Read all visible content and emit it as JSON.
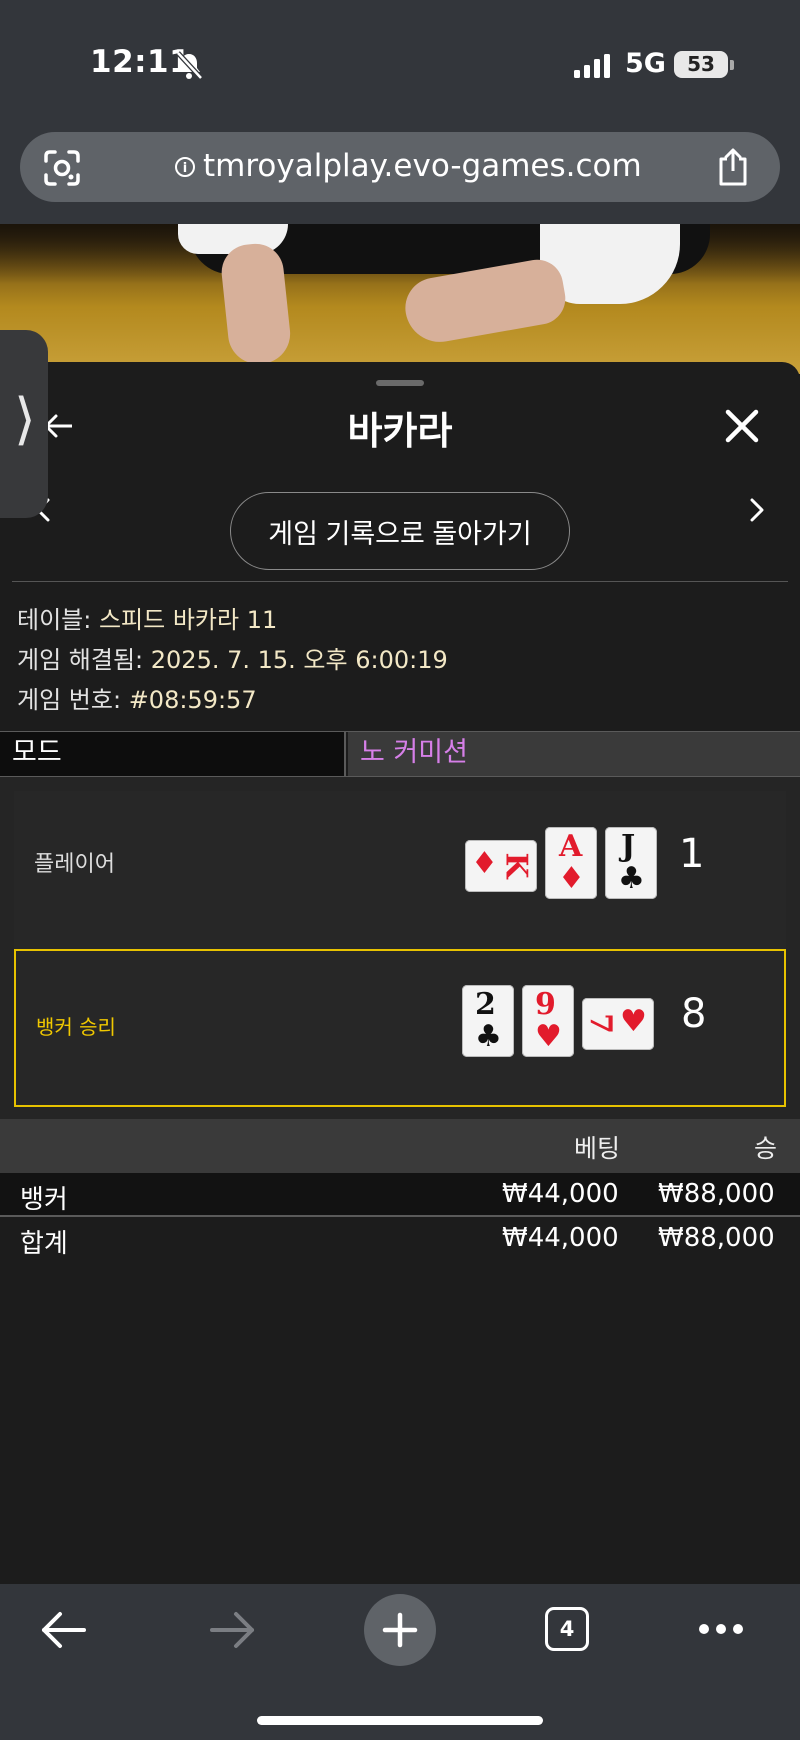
{
  "status": {
    "time": "12:11",
    "network": "5G",
    "battery": "53"
  },
  "browser": {
    "url": "tmroyalplay.evo-games.com",
    "tab_count": "4"
  },
  "panel": {
    "title": "바카라",
    "back_to_history": "게임 기록으로 돌아가기",
    "table_label": "테이블:",
    "table_value": "스피드 바카라 11",
    "resolved_label": "게임 해결됨:",
    "resolved_value": "2025. 7. 15. 오후 6:00:19",
    "game_no_label": "게임 번호:",
    "game_no_value": "#08:59:57",
    "mode_label": "모드",
    "mode_value": "노 커미션"
  },
  "hands": {
    "player": {
      "label": "플레이어",
      "score": "1",
      "cards": [
        {
          "rank": "K",
          "suit": "♦",
          "color": "red",
          "orientation": "horizontal"
        },
        {
          "rank": "A",
          "suit": "♦",
          "color": "red",
          "orientation": "vertical"
        },
        {
          "rank": "J",
          "suit": "♣",
          "color": "black",
          "orientation": "vertical"
        }
      ]
    },
    "banker": {
      "label": "뱅커 승리",
      "score": "8",
      "cards": [
        {
          "rank": "2",
          "suit": "♣",
          "color": "black",
          "orientation": "vertical"
        },
        {
          "rank": "9",
          "suit": "♥",
          "color": "red",
          "orientation": "vertical"
        },
        {
          "rank": "7",
          "suit": "♥",
          "color": "red",
          "orientation": "horizontal"
        }
      ]
    }
  },
  "bets": {
    "headers": {
      "bet": "베팅",
      "win": "승"
    },
    "rows": [
      {
        "name": "뱅커",
        "bet": "₩44,000",
        "win": "₩88,000"
      }
    ],
    "total": {
      "name": "합계",
      "bet": "₩44,000",
      "win": "₩88,000"
    }
  },
  "colors": {
    "winner_border": "#e7c200",
    "mode_value": "#d67fe8",
    "red_suit": "#e21b2c"
  }
}
